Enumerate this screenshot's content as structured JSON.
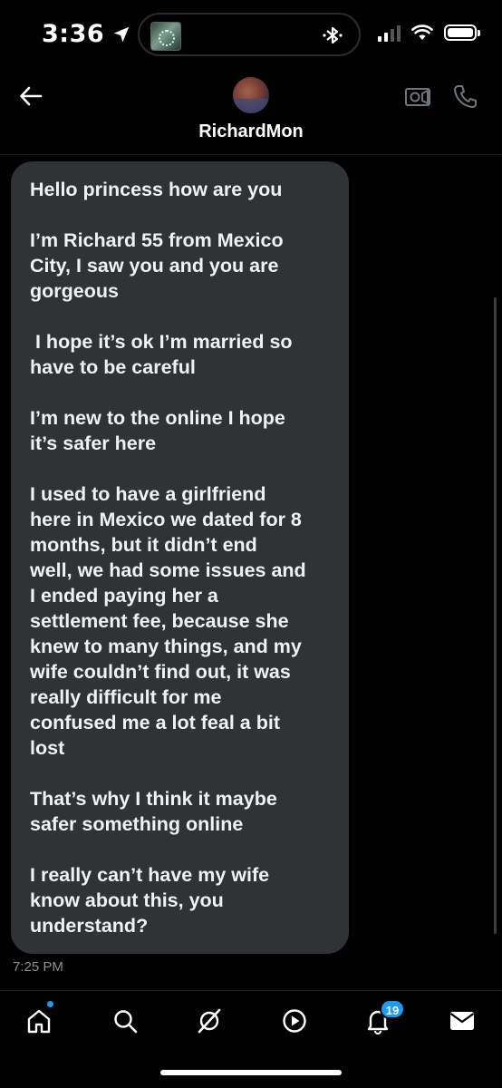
{
  "status_bar": {
    "time": "3:36"
  },
  "header": {
    "contact_name": "RichardMon"
  },
  "conversation": {
    "messages": [
      "Hello princess how are you",
      "I’m Richard 55 from Mexico\nCity, I saw you and you are\ngorgeous",
      " I hope it’s ok I’m married so\nhave to be careful",
      "I’m new to the online I hope\nit’s safer here",
      "I used to have a girlfriend\nhere in Mexico we dated for 8\nmonths, but it didn’t end\nwell, we had some issues and\nI ended paying her a\nsettlement fee, because she\nknew to many things, and my\nwife couldn’t find out, it was\nreally difficult for me\nconfused me a lot feal a bit\nlost",
      "That’s why I think it maybe\nsafer something online",
      "I really can’t have my wife\nknow about this, you\nunderstand?"
    ],
    "timestamp": "7:25 PM"
  },
  "nav": {
    "items": [
      "home-icon",
      "search-icon",
      "grok-icon",
      "spaces-icon",
      "notifications-icon",
      "messages-icon"
    ],
    "notifications_badge": "19"
  },
  "colors": {
    "background": "#000000",
    "bubble": "#2f3336",
    "accent": "#1d9bf0",
    "timestamp": "#8b8f94"
  }
}
